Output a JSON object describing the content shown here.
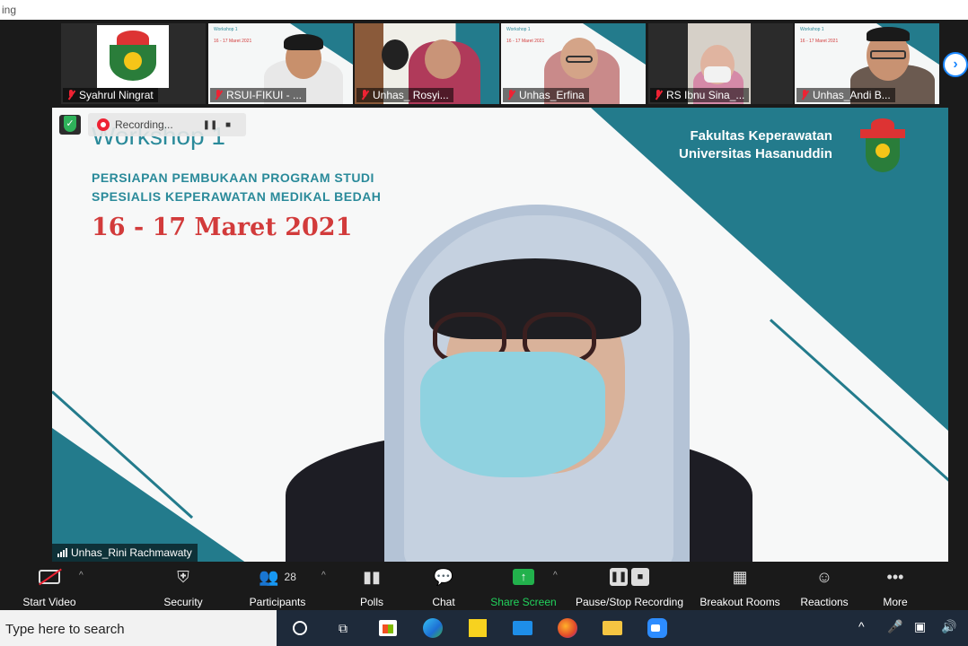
{
  "window": {
    "title_fragment": "ing"
  },
  "thumbnails": [
    {
      "name": "Syahrul Ningrat",
      "muted": true
    },
    {
      "name": "RSUI-FIKUI - ...",
      "muted": true
    },
    {
      "name": "Unhas_ Rosyi...",
      "muted": true
    },
    {
      "name": "Unhas_Erfina",
      "muted": true
    },
    {
      "name": "RS Ibnu Sina_...",
      "muted": true
    },
    {
      "name": "Unhas_Andi B...",
      "muted": true
    }
  ],
  "slide": {
    "title": "Workshop 1",
    "subtitle_line1": "PERSIAPAN PEMBUKAAN PROGRAM STUDI",
    "subtitle_line2": "SPESIALIS KEPERAWATAN MEDIKAL BEDAH",
    "date": "16 - 17 Maret 2021",
    "faculty_line1": "Fakultas Keperawatan",
    "faculty_line2": "Universitas Hasanuddin"
  },
  "recording": {
    "label": "Recording..."
  },
  "active_speaker": "Unhas_Rini Rachmawaty",
  "toolbar": {
    "start_video": "Start Video",
    "security": "Security",
    "participants": "Participants",
    "participants_count": "28",
    "polls": "Polls",
    "chat": "Chat",
    "share_screen": "Share Screen",
    "pause_stop_recording": "Pause/Stop Recording",
    "breakout_rooms": "Breakout Rooms",
    "reactions": "Reactions",
    "more": "More"
  },
  "taskbar": {
    "search_placeholder": "Type here to search"
  },
  "colors": {
    "teal": "#237b8c",
    "red_text": "#d23b3b",
    "share_green": "#22b14c"
  }
}
